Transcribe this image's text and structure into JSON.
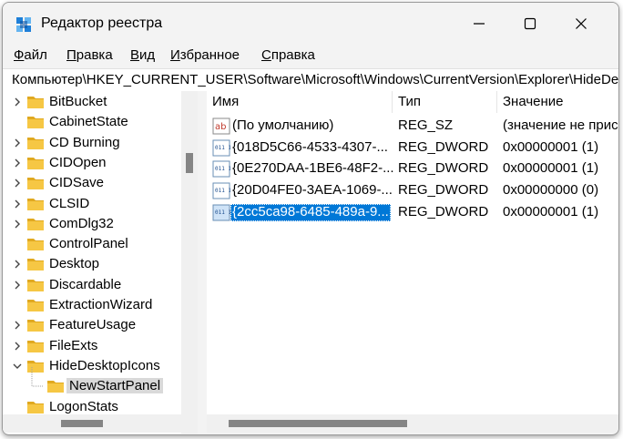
{
  "window": {
    "title": "Редактор реестра"
  },
  "menu": [
    {
      "label": "Файл"
    },
    {
      "label": "Правка"
    },
    {
      "label": "Вид"
    },
    {
      "label": "Избранное"
    },
    {
      "label": "Справка"
    }
  ],
  "address": {
    "path": "Компьютер\\HKEY_CURRENT_USER\\Software\\Microsoft\\Windows\\CurrentVersion\\Explorer\\HideDesktopIcons\\NewStartPanel"
  },
  "tree": {
    "items": [
      {
        "label": "BitBucket",
        "expandable": true
      },
      {
        "label": "CabinetState",
        "expandable": false
      },
      {
        "label": "CD Burning",
        "expandable": true
      },
      {
        "label": "CIDOpen",
        "expandable": true
      },
      {
        "label": "CIDSave",
        "expandable": true
      },
      {
        "label": "CLSID",
        "expandable": true
      },
      {
        "label": "ComDlg32",
        "expandable": true
      },
      {
        "label": "ControlPanel",
        "expandable": false
      },
      {
        "label": "Desktop",
        "expandable": true
      },
      {
        "label": "Discardable",
        "expandable": true
      },
      {
        "label": "ExtractionWizard",
        "expandable": false
      },
      {
        "label": "FeatureUsage",
        "expandable": true
      },
      {
        "label": "FileExts",
        "expandable": true
      },
      {
        "label": "HideDesktopIcons",
        "expandable": true,
        "expanded": true
      },
      {
        "label": "NewStartPanel",
        "expandable": false,
        "child": true,
        "selected": true
      },
      {
        "label": "LogonStats",
        "expandable": false
      }
    ]
  },
  "list": {
    "columns": {
      "name": "Имя",
      "type": "Тип",
      "value": "Значение"
    },
    "rows": [
      {
        "icon": "string-value-icon",
        "name": "(По умолчанию)",
        "type": "REG_SZ",
        "value": "(значение не присвоено)"
      },
      {
        "icon": "binary-value-icon",
        "name": "{018D5C66-4533-4307-...",
        "type": "REG_DWORD",
        "value": "0x00000001 (1)"
      },
      {
        "icon": "binary-value-icon",
        "name": "{0E270DAA-1BE6-48F2-...",
        "type": "REG_DWORD",
        "value": "0x00000001 (1)"
      },
      {
        "icon": "binary-value-icon",
        "name": "{20D04FE0-3AEA-1069-...",
        "type": "REG_DWORD",
        "value": "0x00000000 (0)"
      },
      {
        "icon": "binary-value-icon",
        "name": "{2cc5ca98-6485-489a-9...",
        "type": "REG_DWORD",
        "value": "0x00000001 (1)",
        "selected": true
      }
    ]
  },
  "icons": {
    "string_value_text": "ab",
    "binary_value_text": "011 110"
  },
  "colors": {
    "selection": "#0078d7",
    "folder": "#f6c744",
    "folder_dark": "#e0a920",
    "tree_selected": "#d9d9d9"
  }
}
